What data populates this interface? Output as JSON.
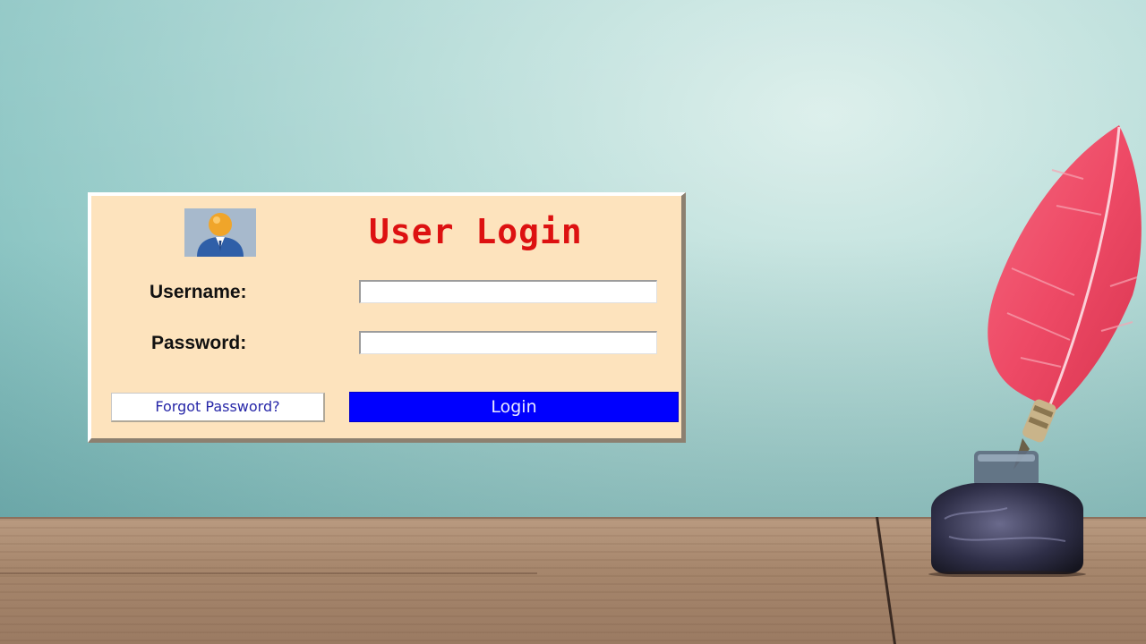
{
  "login": {
    "title": "User Login",
    "username_label": "Username:",
    "username_value": "",
    "password_label": "Password:",
    "password_value": "",
    "forgot_label": "Forgot Password?",
    "login_label": "Login"
  },
  "colors": {
    "panel_background": "#fde3bd",
    "title": "#dd1111",
    "login_button": "#0000ff",
    "forgot_text": "#2727a8",
    "feather": "#f0506a"
  },
  "icons": {
    "avatar": "user-avatar-icon"
  }
}
